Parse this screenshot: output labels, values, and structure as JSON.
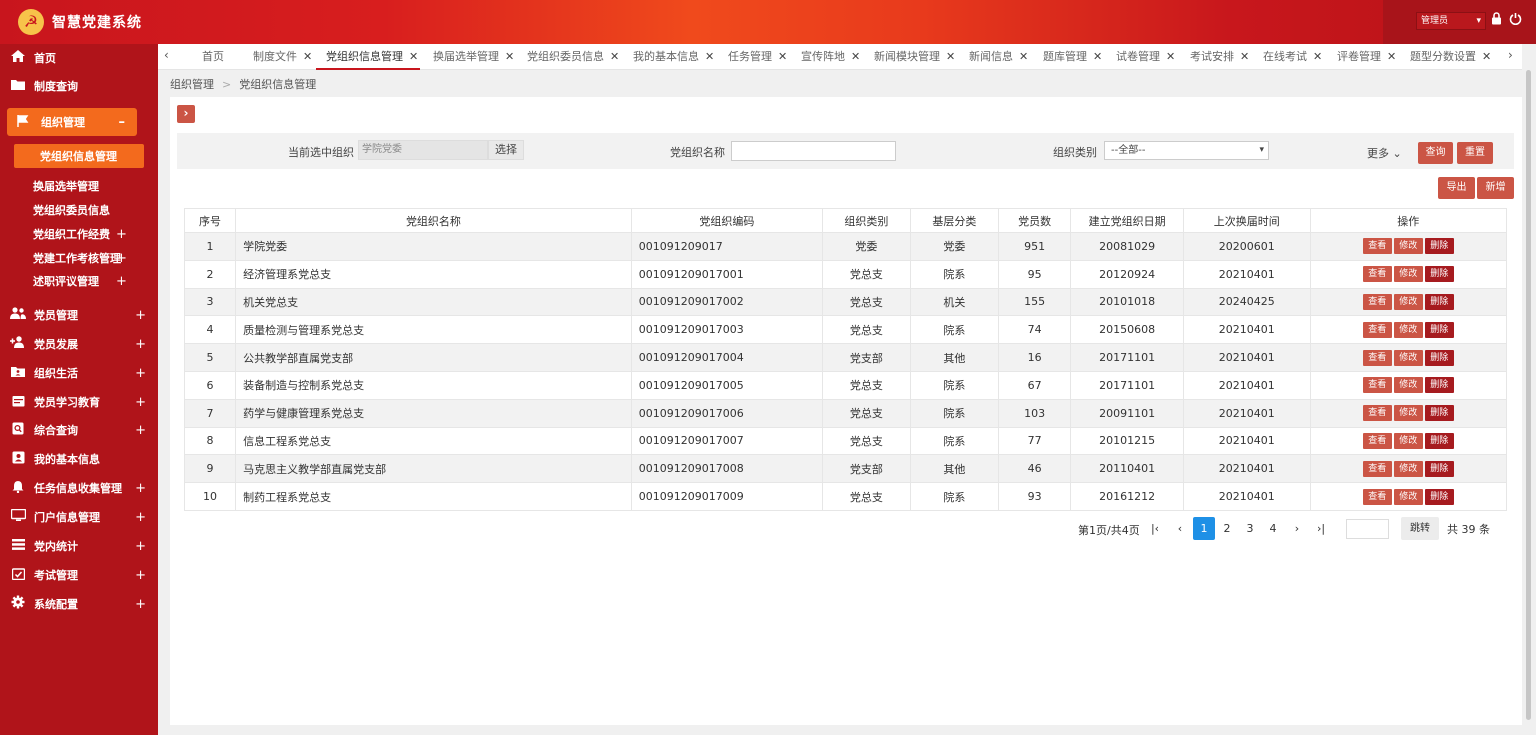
{
  "app": {
    "title": "智慧党建系统",
    "user": "管理员",
    "logo_glyph": "☭"
  },
  "sidebar": {
    "items": [
      {
        "label": "首页",
        "icon": "home-icon",
        "glyph": "⌂"
      },
      {
        "label": "制度查询",
        "icon": "folder-icon",
        "glyph": "▬"
      },
      {
        "label": "组织管理",
        "icon": "flag-icon",
        "glyph": "⚑",
        "expanded_mark": "–"
      },
      {
        "label": "党员管理",
        "icon": "users-icon",
        "glyph": "👥",
        "mark": "+"
      },
      {
        "label": "党员发展",
        "icon": "user-plus-icon",
        "glyph": "👤",
        "mark": "+"
      },
      {
        "label": "组织生活",
        "icon": "folder-user-icon",
        "glyph": "▣",
        "mark": "+"
      },
      {
        "label": "党员学习教育",
        "icon": "calendar-icon",
        "glyph": "▦",
        "mark": "+"
      },
      {
        "label": "综合查询",
        "icon": "search-doc-icon",
        "glyph": "⊡",
        "mark": "+"
      },
      {
        "label": "我的基本信息",
        "icon": "id-card-icon",
        "glyph": "▤"
      },
      {
        "label": "任务信息收集管理",
        "icon": "bell-icon",
        "glyph": "♫",
        "mark": "+"
      },
      {
        "label": "门户信息管理",
        "icon": "monitor-icon",
        "glyph": "▭",
        "mark": "+"
      },
      {
        "label": "党内统计",
        "icon": "list-icon",
        "glyph": "☰",
        "mark": "+"
      },
      {
        "label": "考试管理",
        "icon": "calendar-check-icon",
        "glyph": "☑",
        "mark": "+"
      },
      {
        "label": "系统配置",
        "icon": "gear-icon",
        "glyph": "⚙",
        "mark": "+"
      }
    ],
    "sub_items": [
      {
        "label": "党组织信息管理"
      },
      {
        "label": "换届选举管理"
      },
      {
        "label": "党组织委员信息"
      },
      {
        "label": "党组织工作经费",
        "mark": "+"
      },
      {
        "label": "党建工作考核管理",
        "mark": "+"
      },
      {
        "label": "述职评议管理",
        "mark": "+"
      }
    ]
  },
  "tabs": [
    {
      "label": "首页"
    },
    {
      "label": "制度文件"
    },
    {
      "label": "党组织信息管理"
    },
    {
      "label": "换届选举管理"
    },
    {
      "label": "党组织委员信息"
    },
    {
      "label": "我的基本信息"
    },
    {
      "label": "任务管理"
    },
    {
      "label": "宣传阵地"
    },
    {
      "label": "新闻模块管理"
    },
    {
      "label": "新闻信息"
    },
    {
      "label": "题库管理"
    },
    {
      "label": "试卷管理"
    },
    {
      "label": "考试安排"
    },
    {
      "label": "在线考试"
    },
    {
      "label": "评卷管理"
    },
    {
      "label": "题型分数设置"
    }
  ],
  "breadcrumb": {
    "parent": "组织管理",
    "current": "党组织信息管理"
  },
  "filters": {
    "org_label": "当前选中组织",
    "org_value": "学院党委",
    "choose": "选择",
    "name_label": "党组织名称",
    "name_value": "",
    "category_label": "组织类别",
    "category_value": "--全部--",
    "more": "更多",
    "query": "查询",
    "reset": "重置",
    "export": "导出",
    "add": "新增"
  },
  "table": {
    "headers": [
      "序号",
      "党组织名称",
      "党组织编码",
      "组织类别",
      "基层分类",
      "党员数",
      "建立党组织日期",
      "上次换届时间",
      "操作"
    ],
    "actions": {
      "view": "查看",
      "edit": "修改",
      "delete": "删除"
    },
    "rows": [
      [
        "1",
        "学院党委",
        "001091209017",
        "党委",
        "党委",
        "951",
        "20081029",
        "20200601"
      ],
      [
        "2",
        "经济管理系党总支",
        "001091209017001",
        "党总支",
        "院系",
        "95",
        "20120924",
        "20210401"
      ],
      [
        "3",
        "机关党总支",
        "001091209017002",
        "党总支",
        "机关",
        "155",
        "20101018",
        "20240425"
      ],
      [
        "4",
        "质量检测与管理系党总支",
        "001091209017003",
        "党总支",
        "院系",
        "74",
        "20150608",
        "20210401"
      ],
      [
        "5",
        "公共教学部直属党支部",
        "001091209017004",
        "党支部",
        "其他",
        "16",
        "20171101",
        "20210401"
      ],
      [
        "6",
        "装备制造与控制系党总支",
        "001091209017005",
        "党总支",
        "院系",
        "67",
        "20171101",
        "20210401"
      ],
      [
        "7",
        "药学与健康管理系党总支",
        "001091209017006",
        "党总支",
        "院系",
        "103",
        "20091101",
        "20210401"
      ],
      [
        "8",
        "信息工程系党总支",
        "001091209017007",
        "党总支",
        "院系",
        "77",
        "20101215",
        "20210401"
      ],
      [
        "9",
        "马克思主义教学部直属党支部",
        "001091209017008",
        "党支部",
        "其他",
        "46",
        "20110401",
        "20210401"
      ],
      [
        "10",
        "制药工程系党总支",
        "001091209017009",
        "党总支",
        "院系",
        "93",
        "20161212",
        "20210401"
      ]
    ]
  },
  "pagination": {
    "info": "第1页/共4页",
    "pages": [
      "1",
      "2",
      "3",
      "4"
    ],
    "current": "1",
    "jump": "跳转",
    "total": "共 39 条"
  },
  "colors": {
    "primary": "#c8151d",
    "accent": "#f36a1d",
    "button": "#cb5545",
    "page_active": "#1e90e6"
  }
}
